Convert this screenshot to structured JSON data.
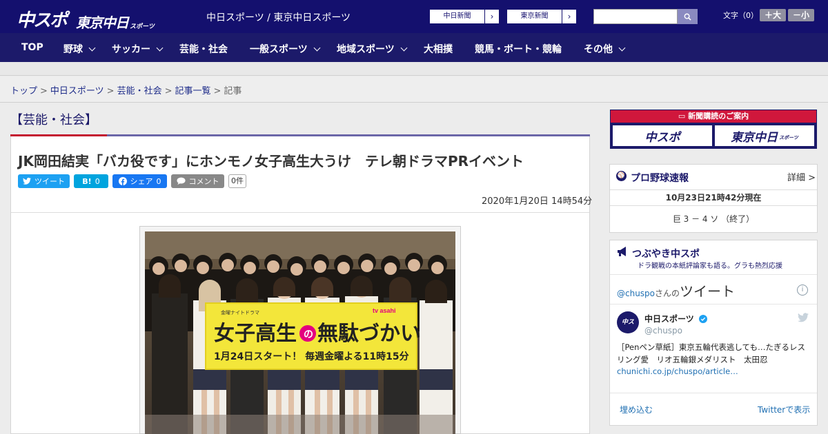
{
  "header": {
    "logo_main": "中スポ",
    "logo_sub": "東京中日",
    "logo_small": "スポーツ",
    "site_name": "中日スポーツ / 東京中日スポーツ",
    "paper_buttons": [
      {
        "label": "中日新聞",
        "arrow": "›"
      },
      {
        "label": "東京新聞",
        "arrow": "›"
      }
    ],
    "search_placeholder": "",
    "font_label": "文字（0）",
    "font_bigger": "＋大",
    "font_smaller": "－小"
  },
  "nav": {
    "items": [
      {
        "label": "TOP",
        "dropdown": false
      },
      {
        "label": "野球",
        "dropdown": true
      },
      {
        "label": "サッカー",
        "dropdown": true
      },
      {
        "label": "芸能・社会",
        "dropdown": false
      },
      {
        "label": "一般スポーツ",
        "dropdown": true
      },
      {
        "label": "地域スポーツ",
        "dropdown": true
      },
      {
        "label": "大相撲",
        "dropdown": false
      },
      {
        "label": "競馬・ボート・競輪",
        "dropdown": false
      },
      {
        "label": "その他",
        "dropdown": true
      }
    ]
  },
  "breadcrumb": {
    "items": [
      "トップ",
      "中日スポーツ",
      "芸能・社会",
      "記事一覧"
    ],
    "current": "記事",
    "separator": ">"
  },
  "article": {
    "category": "【芸能・社会】",
    "headline": "JK岡田結実「バカ役です」にホンモノ女子高生大うけ　テレ朝ドラマPRイベント",
    "share": {
      "tweet": "ツイート",
      "hatena_label": "B!",
      "hatena_count": "0",
      "facebook": "シェア",
      "facebook_count": "0",
      "comment": "コメント",
      "comment_count": "0件"
    },
    "date": "2020年1月20日 14時54分",
    "photo": {
      "banner_small": "金曜ナイトドラマ",
      "banner_title_1": "女子高生",
      "banner_title_no": "の",
      "banner_title_2": "無駄づかい",
      "banner_schedule": "1月24日スタート！ 毎週金曜よる11時15分",
      "tv_logo": "tv asahi"
    }
  },
  "sidebar": {
    "ad": {
      "title": "新聞購読のご案内",
      "left": "中スポ",
      "right": "東京中日",
      "right_small": "スポーツ"
    },
    "baseball": {
      "title": "プロ野球速報",
      "detail": "詳細 >",
      "updated": "10月23日21時42分現在",
      "score": "巨 3 － 4 ソ （終了）"
    },
    "tweets": {
      "title": "つぶやき中スポ",
      "subtitle": "ドラ観戦の本紙評論家も語る。グラも熱烈応援",
      "header_handle": "@chuspo",
      "header_san": "さんの",
      "header_tweet": "ツイート",
      "info": "i",
      "user_name": "中日スポーツ",
      "user_handle": "@chuspo",
      "tweet_text": "［Penペン草紙］東京五輪代表逃しても…たぎるレスリング愛　リオ五輪銀メダリスト　太田忍",
      "tweet_link": "chunichi.co.jp/chuspo/article…",
      "embed": "埋め込む",
      "view_on": "Twitterで表示"
    }
  },
  "colors": {
    "header_bg": "#14106e",
    "nav_bg": "#1c1a6a",
    "accent_red": "#c4122f",
    "twitter": "#1da1f2",
    "hatena": "#00a4de",
    "facebook": "#1877f2"
  }
}
